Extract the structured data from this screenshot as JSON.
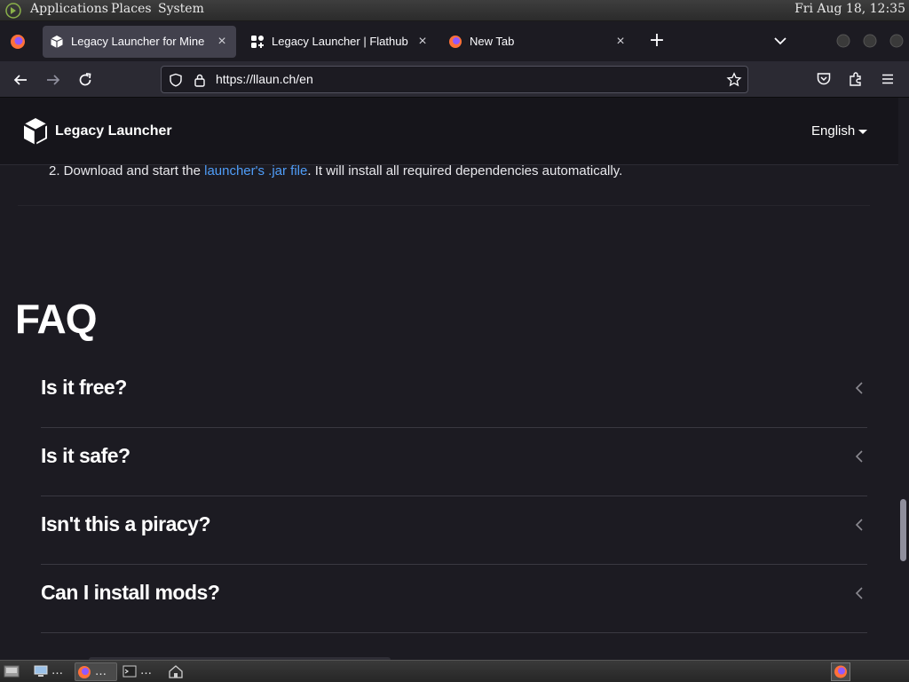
{
  "panel": {
    "applications": "Applications",
    "places": "Places",
    "system": "System",
    "clock": "Fri Aug 18, 12:35"
  },
  "tabs": [
    {
      "title": "Legacy Launcher for Mine",
      "selected": true
    },
    {
      "title": "Legacy Launcher | Flathub",
      "selected": false
    },
    {
      "title": "New Tab",
      "selected": false
    }
  ],
  "tab_close": "×",
  "new_tab": "+",
  "url": "https://llaun.ch/en",
  "site": {
    "brand": "Legacy Launcher",
    "language": "English"
  },
  "install": {
    "step_prefix": "2. Download and start the ",
    "step_link": "launcher's .jar file",
    "step_suffix": ". It will install all required dependencies automatically."
  },
  "faq": {
    "title": "FAQ",
    "items": [
      {
        "question": "Is it free?"
      },
      {
        "question": "Is it safe?"
      },
      {
        "question": "Isn't this a piracy?"
      },
      {
        "question": "Can I install mods?"
      }
    ]
  },
  "taskbar": {
    "items": [
      {
        "label": "…"
      },
      {
        "label": "…"
      },
      {
        "label": "…"
      }
    ]
  },
  "colors": {
    "page_bg": "#1c1b22",
    "link": "#4f9df8",
    "toolbar": "#2b2a33"
  }
}
